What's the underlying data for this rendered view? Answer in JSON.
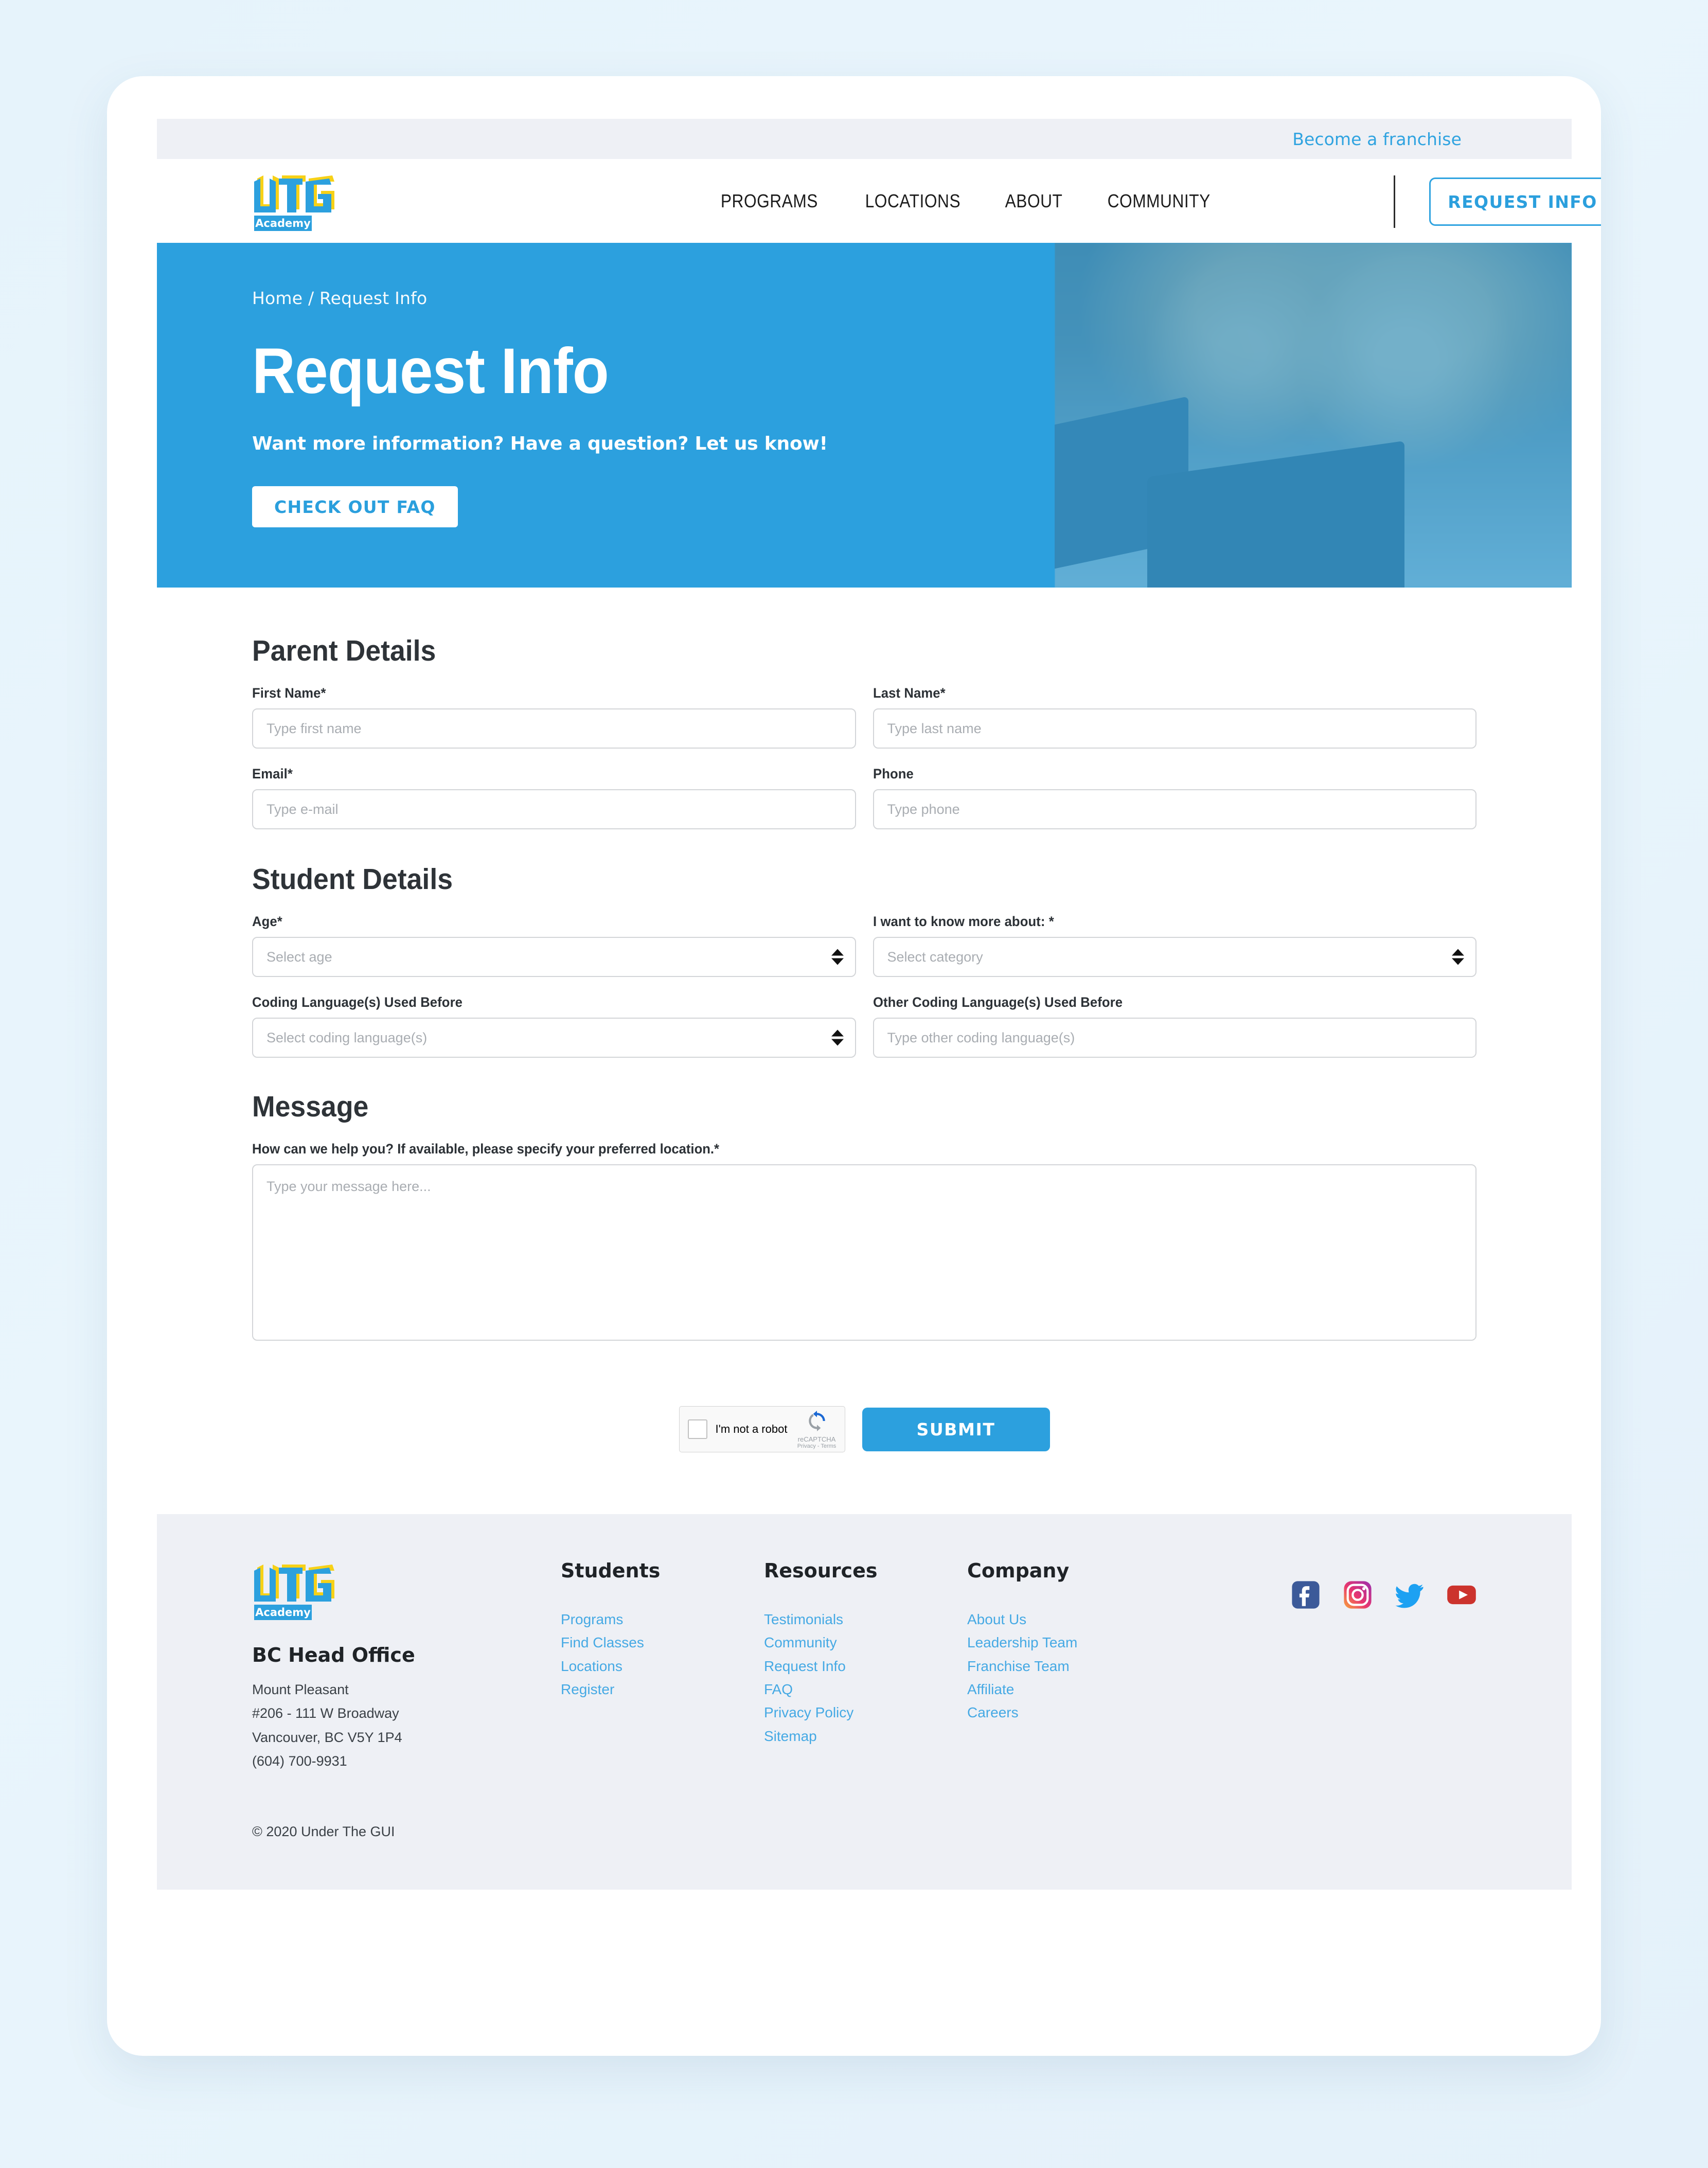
{
  "topbar": {
    "franchise_link": "Become a franchise"
  },
  "header": {
    "logo_text": "UTG",
    "logo_sub": "Academy",
    "nav": [
      {
        "label": "PROGRAMS"
      },
      {
        "label": "LOCATIONS"
      },
      {
        "label": "ABOUT"
      },
      {
        "label": "COMMUNITY"
      }
    ],
    "request_button": "REQUEST INFO"
  },
  "hero": {
    "breadcrumb_home": "Home",
    "breadcrumb_sep": " / ",
    "breadcrumb_current": "Request Info",
    "title": "Request Info",
    "subtitle": "Want more information? Have a question? Let us know!",
    "cta": "CHECK OUT FAQ",
    "bg_color": "#2ca0de"
  },
  "form": {
    "parent_section_title": "Parent Details",
    "student_section_title": "Student Details",
    "message_section_title": "Message",
    "first_name": {
      "label": "First Name*",
      "placeholder": "Type first name",
      "value": ""
    },
    "last_name": {
      "label": "Last Name*",
      "placeholder": "Type last name",
      "value": ""
    },
    "email": {
      "label": "Email*",
      "placeholder": "Type e-mail",
      "value": ""
    },
    "phone": {
      "label": "Phone",
      "placeholder": "Type phone",
      "value": ""
    },
    "age": {
      "label": "Age*",
      "placeholder": "Select age",
      "value": "Select age"
    },
    "category": {
      "label": "I want to know more about: *",
      "placeholder": "Select category",
      "value": "Select category"
    },
    "coding_langs": {
      "label": "Coding Language(s) Used Before",
      "placeholder": "Select coding language(s)",
      "value": "Select coding language(s)"
    },
    "other_langs": {
      "label": "Other Coding Language(s) Used Before",
      "placeholder": "Type other coding language(s)",
      "value": ""
    },
    "message": {
      "label": "How can we help you? If available, please specify your preferred location.*",
      "placeholder": "Type your message here...",
      "value": ""
    },
    "captcha": {
      "label": "I'm not a robot",
      "brand": "reCAPTCHA",
      "terms": "Privacy - Terms",
      "checked": false
    },
    "submit_label": "SUBMIT"
  },
  "footer": {
    "logo_text": "UTG",
    "logo_sub": "Academy",
    "office_title": "BC Head Office",
    "address_lines": [
      "Mount Pleasant",
      "#206 - 111 W Broadway",
      "Vancouver, BC V5Y 1P4",
      "(604) 700-9931"
    ],
    "columns": [
      {
        "heading": "Students",
        "links": [
          "Programs",
          "Find Classes",
          "Locations",
          "Register"
        ]
      },
      {
        "heading": "Resources",
        "links": [
          "Testimonials",
          "Community",
          "Request Info",
          "FAQ",
          "Privacy Policy",
          "Sitemap"
        ]
      },
      {
        "heading": "Company",
        "links": [
          "About Us",
          "Leadership Team",
          "Franchise Team",
          "Affiliate",
          "Careers"
        ]
      }
    ],
    "socials": [
      {
        "name": "facebook-icon",
        "color": "#3c5a99"
      },
      {
        "name": "instagram-icon",
        "color": "#d6249f"
      },
      {
        "name": "twitter-icon",
        "color": "#1da1f2"
      },
      {
        "name": "youtube-icon",
        "color": "#cc332d"
      }
    ],
    "copyright": "© 2020 Under The GUI"
  },
  "colors": {
    "brand_blue": "#2ca0de",
    "link_blue": "#45a9e4",
    "logo_yellow": "#f7d117",
    "light_grey": "#eef0f5"
  }
}
